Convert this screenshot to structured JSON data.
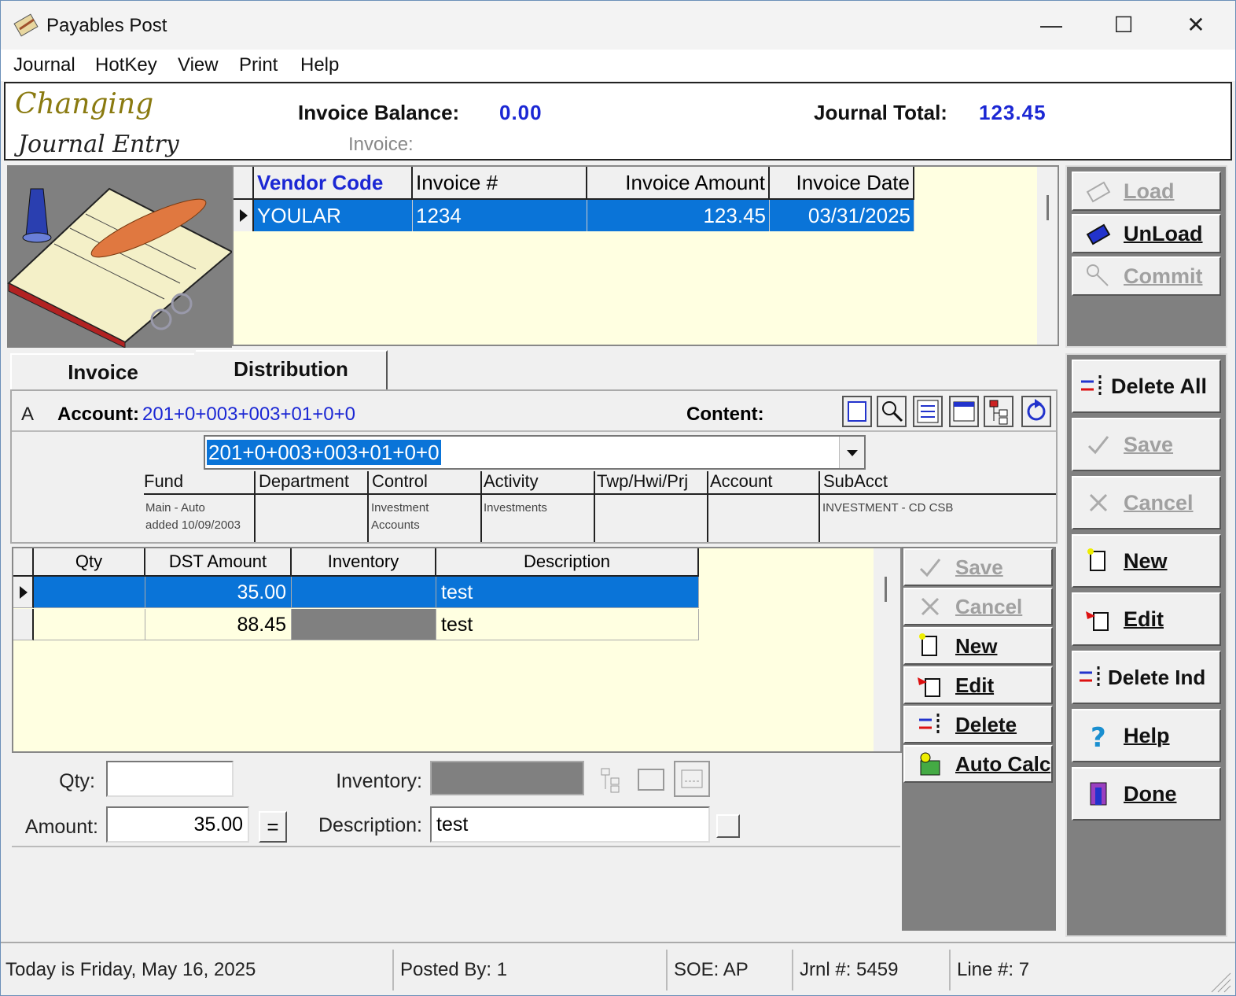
{
  "window": {
    "title": "Payables Post"
  },
  "menu": [
    "Journal",
    "HotKey",
    "View",
    "Print",
    "Help"
  ],
  "header": {
    "mode_line1": "Changing",
    "mode_line2": "Journal Entry",
    "invoice_balance_label": "Invoice Balance:",
    "invoice_balance_value": "0.00",
    "journal_total_label": "Journal Total:",
    "journal_total_value": "123.45",
    "invoice_label": "Invoice:"
  },
  "invoice_grid": {
    "columns": [
      "Vendor Code",
      "Invoice #",
      "Invoice Amount",
      "Invoice Date"
    ],
    "rows": [
      {
        "vendor": "YOULAR",
        "invoice_no": "1234",
        "amount": "123.45",
        "date": "03/31/2025"
      }
    ]
  },
  "top_buttons": {
    "load": "Load",
    "unload": "UnLoad",
    "commit": "Commit"
  },
  "tabs": {
    "invoice": "Invoice",
    "distribution": "Distribution"
  },
  "distribution": {
    "indicator": "A",
    "account_label": "Account:",
    "account_value": "201+0+003+003+01+0+0",
    "content_label": "Content:",
    "account_combo_value": "201+0+003+003+01+0+0",
    "segments": [
      {
        "head": "Fund",
        "line1": "Main - Auto",
        "line2": "added 10/09/2003"
      },
      {
        "head": "Department",
        "line1": "",
        "line2": ""
      },
      {
        "head": "Control",
        "line1": "Investment",
        "line2": "Accounts"
      },
      {
        "head": "Activity",
        "line1": "Investments",
        "line2": ""
      },
      {
        "head": "Twp/Hwi/Prj",
        "line1": "",
        "line2": ""
      },
      {
        "head": "Account",
        "line1": "",
        "line2": ""
      },
      {
        "head": "SubAcct",
        "line1": "INVESTMENT - CD CSB",
        "line2": ""
      }
    ]
  },
  "dst_grid": {
    "columns": [
      "Qty",
      "DST Amount",
      "Inventory",
      "Description"
    ],
    "rows": [
      {
        "qty": "",
        "amount": "35.00",
        "inventory": "",
        "description": "test"
      },
      {
        "qty": "",
        "amount": "88.45",
        "inventory": "",
        "description": "test"
      }
    ]
  },
  "dst_buttons": {
    "save": "Save",
    "cancel": "Cancel",
    "new": "New",
    "edit": "Edit",
    "delete": "Delete",
    "auto_calc": "Auto Calc"
  },
  "form": {
    "qty_label": "Qty:",
    "qty_value": "",
    "amount_label": "Amount:",
    "amount_value": "35.00",
    "equals_label": "=",
    "inventory_label": "Inventory:",
    "description_label": "Description:",
    "description_value": "test"
  },
  "right_buttons": {
    "delete_all": "Delete All",
    "save": "Save",
    "cancel": "Cancel",
    "new": "New",
    "edit": "Edit",
    "delete_ind": "Delete Ind",
    "help": "Help",
    "done": "Done"
  },
  "status": {
    "today": "Today is  Friday, May 16, 2025",
    "posted_by": "Posted By: 1",
    "soe": "SOE: AP",
    "jrnl": "Jrnl #: 5459",
    "line": "Line #: 7"
  },
  "colors": {
    "grid_bg": "#ffffe1",
    "selection": "#0a74d8",
    "value_blue": "#1b27d4",
    "script_gold": "#8a7a10"
  }
}
